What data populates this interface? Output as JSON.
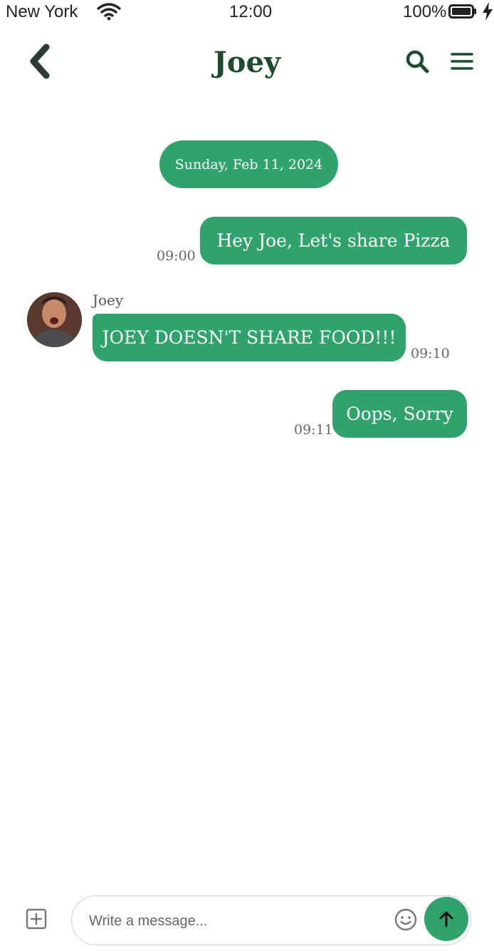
{
  "status_bar": {
    "carrier": "New York",
    "time": "12:00",
    "battery": "100%"
  },
  "header": {
    "title": "Joey",
    "icons": [
      "chevron-left-icon",
      "search-icon",
      "menu-icon"
    ]
  },
  "conversation": {
    "date_separator": "Sunday, Feb 11, 2024",
    "messages": [
      {
        "direction": "outgoing",
        "text": "Hey Joe, Let's share Pizza",
        "time": "09:00"
      },
      {
        "direction": "incoming",
        "sender": "Joey",
        "text": "JOEY DOESN'T SHARE FOOD!!!",
        "time": "09:10"
      },
      {
        "direction": "outgoing",
        "text": "Oops, Sorry",
        "time": "09:11"
      }
    ]
  },
  "composer": {
    "placeholder": "Write a message...",
    "icons": [
      "plus-square-icon",
      "smiley-icon",
      "arrow-up-icon"
    ]
  },
  "colors": {
    "accent": "#2fa36b",
    "title": "#1e4a2f"
  }
}
